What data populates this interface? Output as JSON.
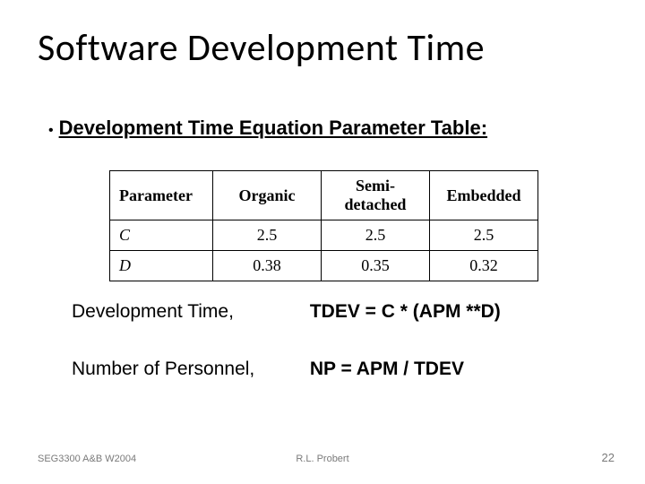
{
  "title": "Software Development Time",
  "bullet": "Development Time Equation Parameter Table:",
  "table": {
    "headers": {
      "parameter": "Parameter",
      "organic": "Organic",
      "semidetached": "Semi-detached",
      "embedded": "Embedded"
    },
    "rows": [
      {
        "label": "C",
        "organic": "2.5",
        "semidetached": "2.5",
        "embedded": "2.5"
      },
      {
        "label": "D",
        "organic": "0.38",
        "semidetached": "0.35",
        "embedded": "0.32"
      }
    ]
  },
  "equations": [
    {
      "lhs": "Development Time,",
      "rhs": "TDEV = C * (APM **D)"
    },
    {
      "lhs": "Number of Personnel,",
      "rhs": "NP = APM / TDEV"
    }
  ],
  "footer": {
    "left": "SEG3300 A&B W2004",
    "center": "R.L. Probert",
    "right": "22"
  }
}
